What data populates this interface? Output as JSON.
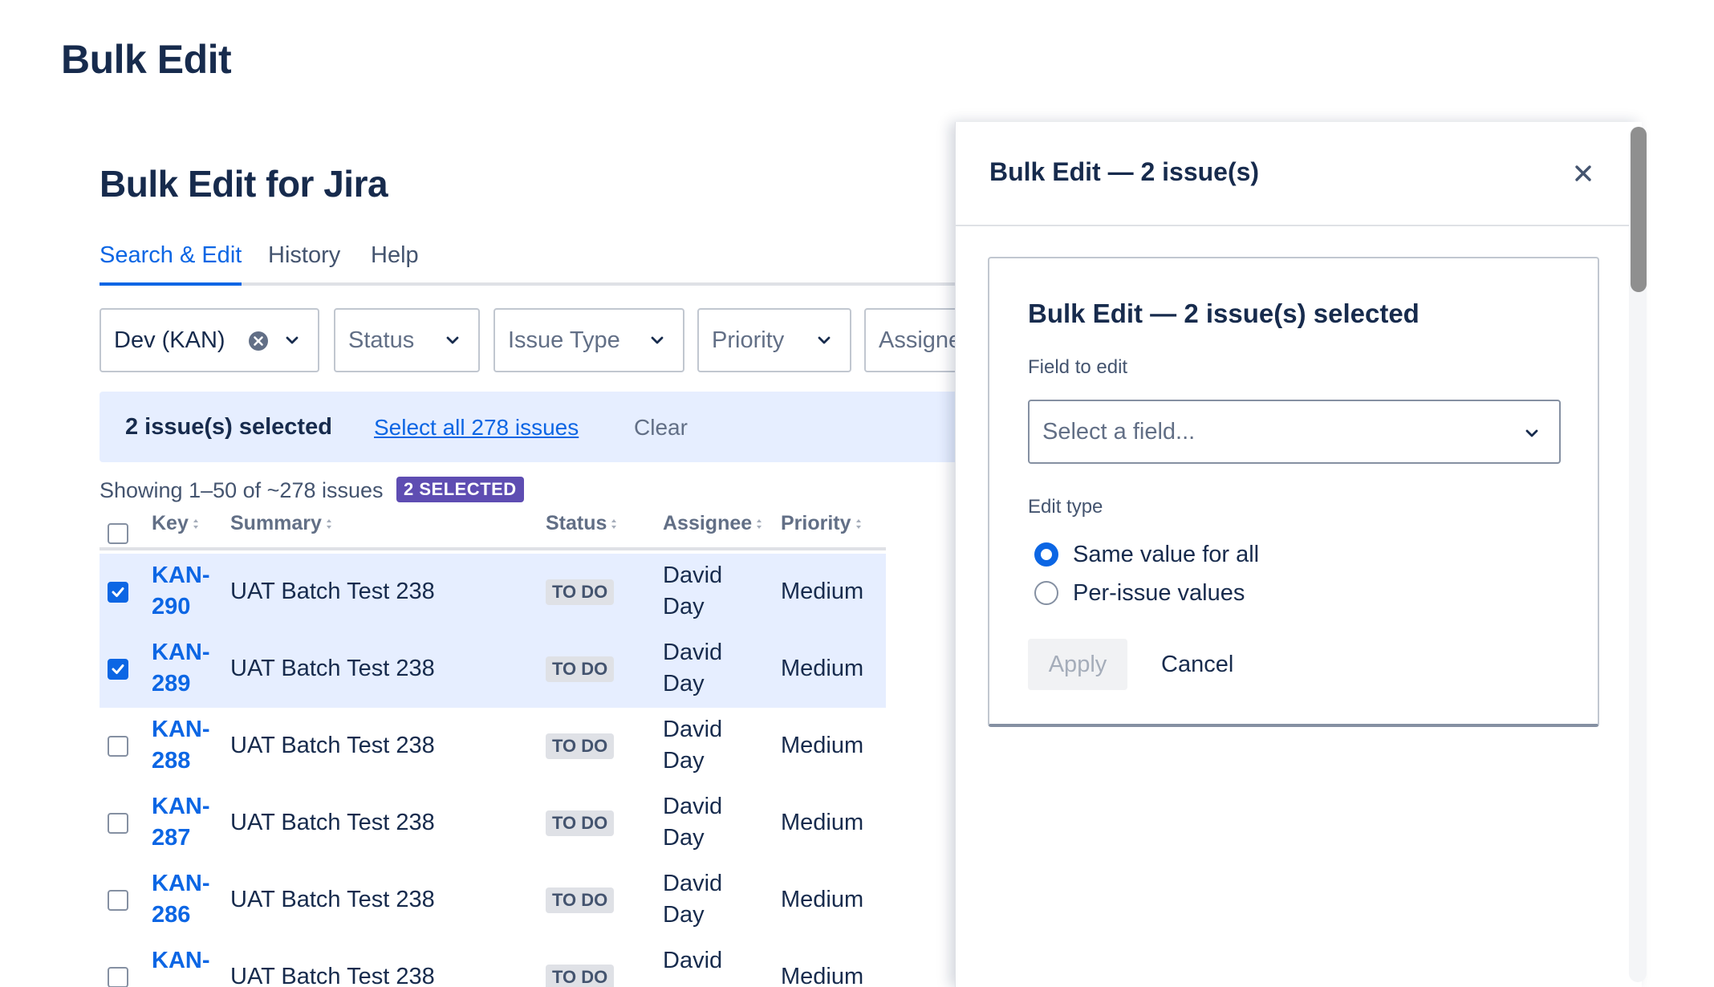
{
  "page": {
    "title": "Bulk Edit"
  },
  "main": {
    "title": "Bulk Edit for Jira",
    "tabs": [
      {
        "label": "Search & Edit",
        "active": true
      },
      {
        "label": "History",
        "active": false
      },
      {
        "label": "Help",
        "active": false
      }
    ],
    "filters": {
      "project": "Dev (KAN)",
      "status": "Status",
      "issue_type": "Issue Type",
      "priority": "Priority",
      "assignee": "Assignee"
    },
    "selection": {
      "count_text": "2 issue(s) selected",
      "select_all": "Select all 278 issues",
      "clear": "Clear"
    },
    "showing": "Showing 1–50 of ~278 issues",
    "selected_badge": "2 SELECTED",
    "table": {
      "columns": [
        "Key",
        "Summary",
        "Status",
        "Assignee",
        "Priority"
      ],
      "rows": [
        {
          "key": "KAN-290",
          "summary": "UAT Batch Test 238",
          "status": "TO DO",
          "assignee": "David Day",
          "priority": "Medium",
          "checked": true
        },
        {
          "key": "KAN-289",
          "summary": "UAT Batch Test 238",
          "status": "TO DO",
          "assignee": "David Day",
          "priority": "Medium",
          "checked": true
        },
        {
          "key": "KAN-288",
          "summary": "UAT Batch Test 238",
          "status": "TO DO",
          "assignee": "David Day",
          "priority": "Medium",
          "checked": false
        },
        {
          "key": "KAN-287",
          "summary": "UAT Batch Test 238",
          "status": "TO DO",
          "assignee": "David Day",
          "priority": "Medium",
          "checked": false
        },
        {
          "key": "KAN-286",
          "summary": "UAT Batch Test 238",
          "status": "TO DO",
          "assignee": "David Day",
          "priority": "Medium",
          "checked": false
        },
        {
          "key": "KAN-",
          "summary": "UAT Batch Test 238",
          "status": "TO DO",
          "assignee": "David",
          "priority": "Medium",
          "checked": false
        }
      ]
    }
  },
  "panel": {
    "title": "Bulk Edit — 2 issue(s)",
    "card_title": "Bulk Edit — 2 issue(s) selected",
    "field_label": "Field to edit",
    "field_placeholder": "Select a field...",
    "edit_type_label": "Edit type",
    "edit_types": [
      {
        "label": "Same value for all",
        "selected": true
      },
      {
        "label": "Per-issue values",
        "selected": false
      }
    ],
    "apply": "Apply",
    "cancel": "Cancel"
  },
  "colors": {
    "accent": "#0c66e4",
    "selected_row": "#e6eeff",
    "badge": "#5e4db2",
    "text": "#172b4d"
  },
  "icons": [
    "clear-icon",
    "chevron-down-icon",
    "sort-icon",
    "checkmark-icon",
    "close-icon"
  ]
}
